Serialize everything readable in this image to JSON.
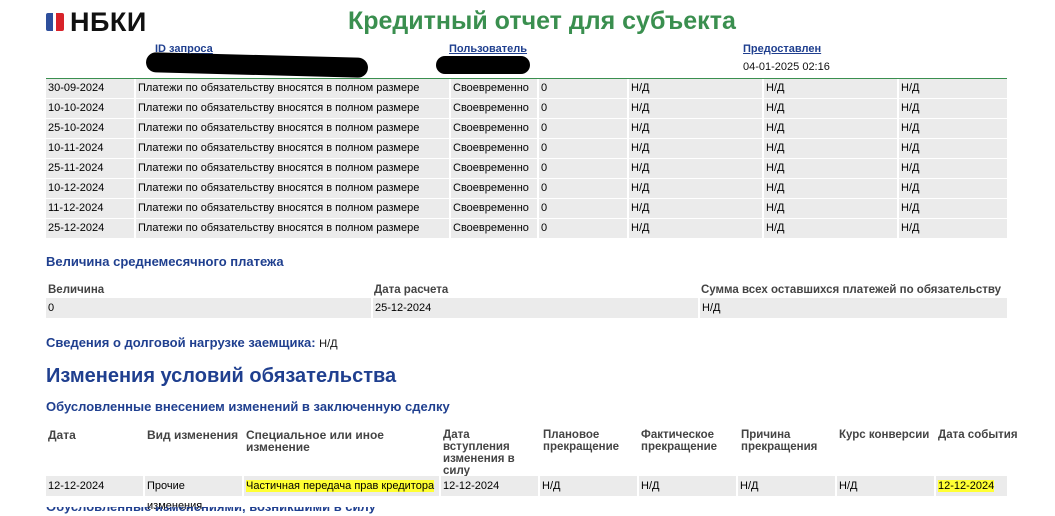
{
  "header": {
    "logo_text": "НБКИ",
    "title": "Кредитный отчет для субъекта"
  },
  "meta": {
    "id_label": "ID запроса",
    "user_label": "Пользователь",
    "provided_label": "Предоставлен",
    "provided_value": "04-01-2025 02:16"
  },
  "payments": {
    "rows": [
      [
        "30-09-2024",
        "Платежи по обязательству вносятся в полном размере",
        "Своевременно",
        "0",
        "Н/Д",
        "Н/Д",
        "Н/Д"
      ],
      [
        "10-10-2024",
        "Платежи по обязательству вносятся в полном размере",
        "Своевременно",
        "0",
        "Н/Д",
        "Н/Д",
        "Н/Д"
      ],
      [
        "25-10-2024",
        "Платежи по обязательству вносятся в полном размере",
        "Своевременно",
        "0",
        "Н/Д",
        "Н/Д",
        "Н/Д"
      ],
      [
        "10-11-2024",
        "Платежи по обязательству вносятся в полном размере",
        "Своевременно",
        "0",
        "Н/Д",
        "Н/Д",
        "Н/Д"
      ],
      [
        "25-11-2024",
        "Платежи по обязательству вносятся в полном размере",
        "Своевременно",
        "0",
        "Н/Д",
        "Н/Д",
        "Н/Д"
      ],
      [
        "10-12-2024",
        "Платежи по обязательству вносятся в полном размере",
        "Своевременно",
        "0",
        "Н/Д",
        "Н/Д",
        "Н/Д"
      ],
      [
        "11-12-2024",
        "Платежи по обязательству вносятся в полном размере",
        "Своевременно",
        "0",
        "Н/Д",
        "Н/Д",
        "Н/Д"
      ],
      [
        "25-12-2024",
        "Платежи по обязательству вносятся в полном размере",
        "Своевременно",
        "0",
        "Н/Д",
        "Н/Д",
        "Н/Д"
      ]
    ]
  },
  "avg_payment": {
    "title": "Величина среднемесячного платежа",
    "headers": [
      "Величина",
      "Дата расчета",
      "Сумма всех оставшихся платежей по обязательству"
    ],
    "values": [
      "0",
      "25-12-2024",
      "Н/Д"
    ]
  },
  "debt_load": {
    "label": "Сведения о долговой нагрузке заемщика:",
    "value": "Н/Д"
  },
  "changes": {
    "title": "Изменения условий обязательства",
    "subtitle": "Обусловленные внесением изменений в заключенную сделку",
    "headers": [
      "Дата",
      "Вид изменения",
      "Специальное или иное изменение",
      "Дата вступления изменения в силу",
      "Плановое прекращение",
      "Фактическое прекращение",
      "Причина прекращения",
      "Курс конверсии",
      "Дата события"
    ],
    "row": [
      "12-12-2024",
      "Прочие изменения",
      "Частичная передача прав кредитора",
      "12-12-2024",
      "Н/Д",
      "Н/Д",
      "Н/Д",
      "Н/Д",
      "12-12-2024"
    ]
  },
  "next_section_partial": "Обусловленные изменениями, возникшими в силу закона или иных обстоятельств"
}
